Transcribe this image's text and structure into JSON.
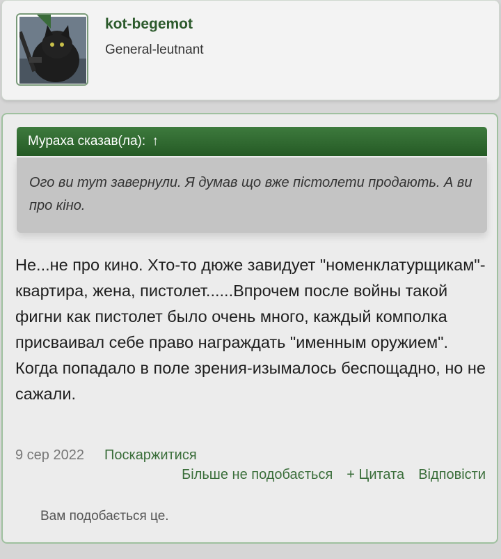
{
  "user": {
    "name": "kot-begemot",
    "title": "General-leutnant"
  },
  "quote": {
    "header": "Мураха сказав(ла):",
    "arrow": "↑",
    "text": "Ого ви тут завернули. Я думав що вже пістолети продають. А ви про кіно."
  },
  "post": {
    "text": "Не...не про кино. Хто-то дюже завидует \"номенклатурщикам\"-квартира, жена, пистолет......Впрочем после войны такой фигни как пистолет было очень много, каждый комполка присваивал себе право награждать \"именным оружием\". Когда попадало в поле зрения-изымалось беспощадно, но не сажали.",
    "date": "9 сер 2022",
    "report": "Поскаржитися"
  },
  "actions": {
    "unlike": "Більше не подобається",
    "quote": "+ Цитата",
    "reply": "Відповісти"
  },
  "likes": "Вам подобається це.",
  "colors": {
    "accent": "#3a6e3a",
    "quote_header": "#2f6b2f",
    "quote_body": "#c4c4c4"
  }
}
